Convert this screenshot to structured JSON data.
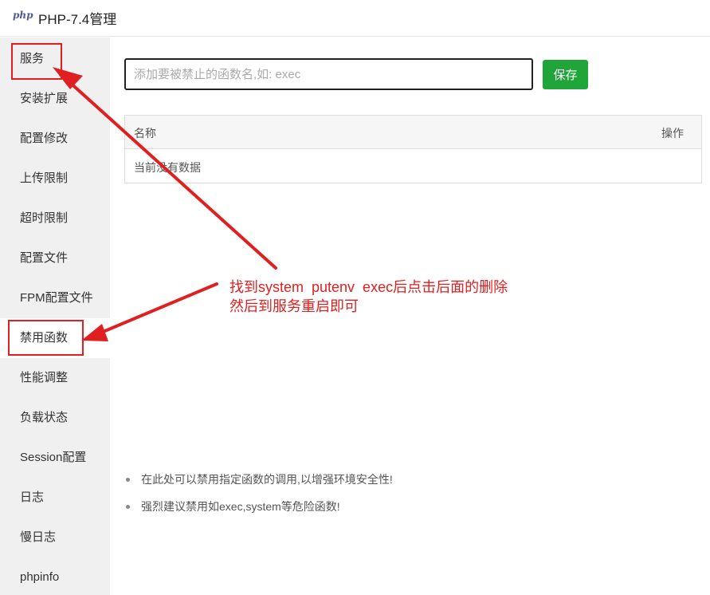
{
  "window": {
    "logo_text": "php",
    "title": "PHP-7.4管理"
  },
  "sidebar": {
    "items": [
      {
        "label": "服务"
      },
      {
        "label": "安装扩展"
      },
      {
        "label": "配置修改"
      },
      {
        "label": "上传限制"
      },
      {
        "label": "超时限制"
      },
      {
        "label": "配置文件"
      },
      {
        "label": "FPM配置文件"
      },
      {
        "label": "禁用函数"
      },
      {
        "label": "性能调整"
      },
      {
        "label": "负载状态"
      },
      {
        "label": "Session配置"
      },
      {
        "label": "日志"
      },
      {
        "label": "慢日志"
      },
      {
        "label": "phpinfo"
      }
    ],
    "active_label": "禁用函数"
  },
  "main": {
    "search": {
      "placeholder": "添加要被禁止的函数名,如: exec",
      "value": ""
    },
    "save_label": "保存",
    "table": {
      "columns": [
        "名称",
        "操作"
      ],
      "empty_text": "当前没有数据"
    },
    "tips": [
      "在此处可以禁用指定函数的调用,以增强环境安全性!",
      "强烈建议禁用如exec,system等危险函数!"
    ]
  },
  "annotation": {
    "line1": "找到system  putenv  exec后点击后面的删除",
    "line2": "然后到服务重启即可"
  },
  "colors": {
    "accent_green": "#20a53a",
    "annotation_red": "#e02020",
    "sidebar_bg": "#f0f0f0"
  }
}
